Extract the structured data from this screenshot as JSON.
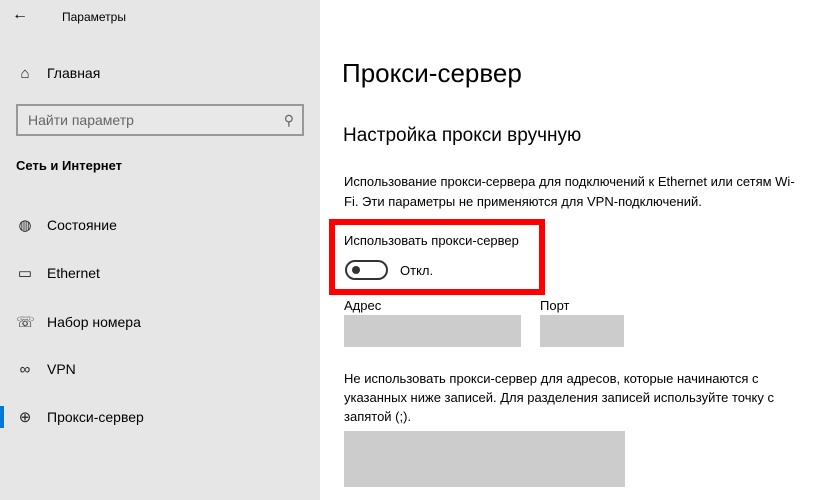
{
  "window": {
    "title": "Параметры"
  },
  "sidebar": {
    "home": "Главная",
    "search_placeholder": "Найти параметр",
    "section": "Сеть и Интернет",
    "items": [
      {
        "label": "Состояние",
        "icon": "network-status-icon"
      },
      {
        "label": "Ethernet",
        "icon": "ethernet-icon"
      },
      {
        "label": "Набор номера",
        "icon": "dial-up-icon"
      },
      {
        "label": "VPN",
        "icon": "vpn-icon"
      },
      {
        "label": "Прокси-сервер",
        "icon": "globe-icon",
        "selected": true
      }
    ]
  },
  "main": {
    "title": "Прокси-сервер",
    "subtitle": "Настройка прокси вручную",
    "description": "Использование прокси-сервера для подключений к Ethernet или сетям Wi-Fi. Эти параметры не применяются для VPN-подключений.",
    "toggle_label": "Использовать прокси-сервер",
    "toggle_state": "Откл.",
    "toggle_on": false,
    "address_label": "Адрес",
    "address_value": "",
    "port_label": "Порт",
    "port_value": "",
    "exceptions_description": "Не использовать прокси-сервер для адресов, которые начинаются с указанных ниже записей. Для разделения записей используйте точку с запятой (;).",
    "exceptions_value": ""
  },
  "colors": {
    "accent": "#0078d7",
    "highlight": "#ff0000",
    "field": "#cccccc"
  }
}
